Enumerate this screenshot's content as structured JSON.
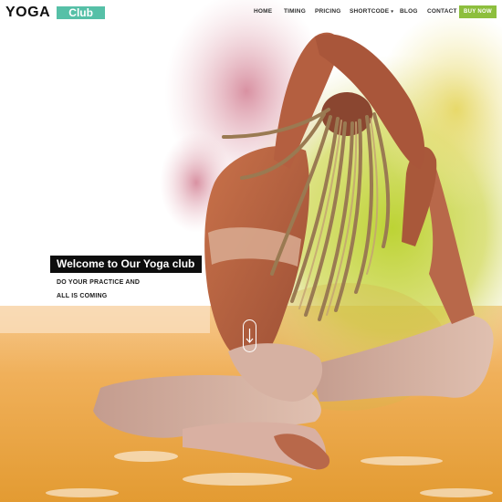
{
  "logo": {
    "main": "YOGA",
    "badge": "Club"
  },
  "nav": {
    "items": [
      "HOME",
      "TIMING",
      "PRICING",
      "SHORTCODE",
      "BLOG",
      "CONTACT"
    ],
    "buy_label": "BUY NOW"
  },
  "hero": {
    "title": "Welcome to Our Yoga club",
    "subtitle_line1": "DO YOUR PRACTICE AND",
    "subtitle_line2": "ALL IS COMING"
  },
  "icons": {
    "scroll": "arrow-down-icon",
    "shortcode": "caret-down-icon"
  },
  "colors": {
    "club_badge": "#56c0a7",
    "buy_button": "#8dbf3d",
    "welcome_bg": "#0d0d0d",
    "floor": "#e9a53c"
  }
}
